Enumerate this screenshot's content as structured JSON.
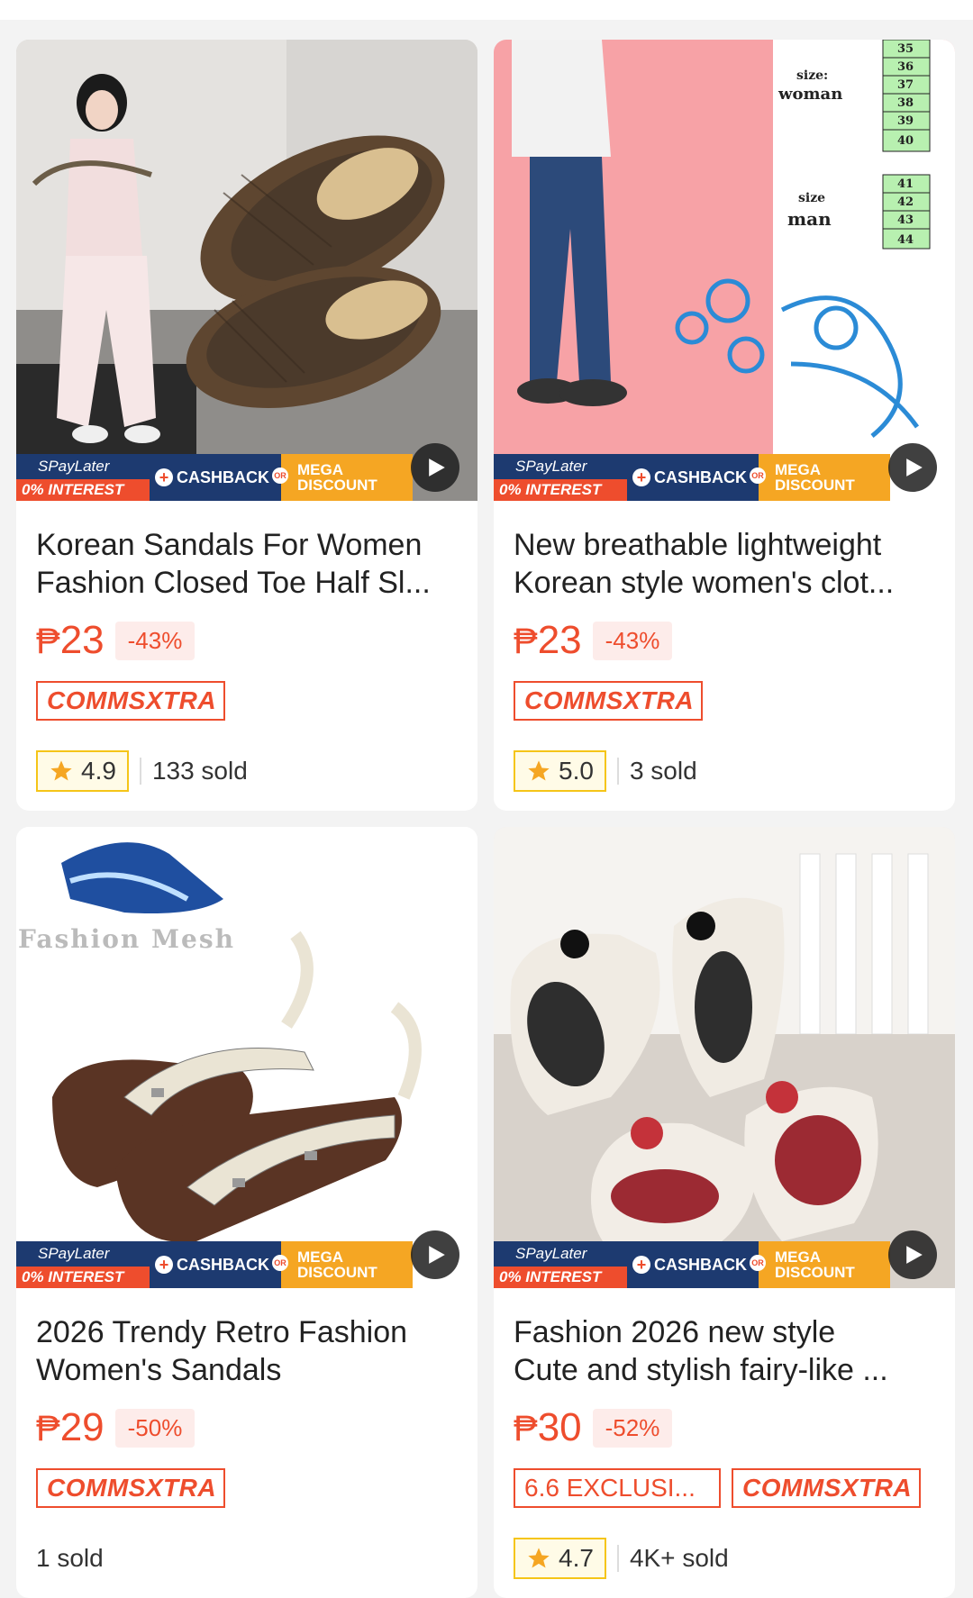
{
  "promo": {
    "spay_label": "SPayLater",
    "spay_interest": "0% INTEREST",
    "cashback": "CASHBACK",
    "or": "OR",
    "mega1": "MEGA",
    "mega2": "DISCOUNT"
  },
  "products": [
    {
      "title_line1": "Korean Sandals For Women",
      "title_line2": "Fashion Closed Toe Half Sl...",
      "currency": "₱",
      "price": "23",
      "discount": "-43%",
      "tags": [
        "COMMSXTRA"
      ],
      "rating": "4.9",
      "sold": "133 sold"
    },
    {
      "title_line1": "New breathable lightweight",
      "title_line2": "Korean style women's clot...",
      "currency": "₱",
      "price": "23",
      "discount": "-43%",
      "tags": [
        "COMMSXTRA"
      ],
      "rating": "5.0",
      "sold": "3 sold",
      "image_text": {
        "size_woman_label": "size:",
        "woman": "woman",
        "size_man_label": "size",
        "man": "man",
        "woman_sizes": [
          "35",
          "36",
          "37",
          "38",
          "39",
          "40"
        ],
        "man_sizes": [
          "41",
          "42",
          "43",
          "44"
        ]
      }
    },
    {
      "title_line1": "2026 Trendy Retro Fashion",
      "title_line2": "Women's Sandals",
      "currency": "₱",
      "price": "29",
      "discount": "-50%",
      "tags": [
        "COMMSXTRA"
      ],
      "rating": "",
      "sold": "1 sold",
      "image_text": {
        "logo": "Fashion Mesh"
      }
    },
    {
      "title_line1": "Fashion 2026 new style",
      "title_line2": "Cute and stylish fairy-like ...",
      "currency": "₱",
      "price": "30",
      "discount": "-52%",
      "tags": [
        "6.6 EXCLUSI...",
        "COMMSXTRA"
      ],
      "rating": "4.7",
      "sold": "4K+ sold"
    }
  ],
  "colors": {
    "accent": "#ee4d2d",
    "navy": "#1d3a70",
    "mega": "#f5a623",
    "star": "#f5c518"
  },
  "icons": [
    "play-icon",
    "star-icon",
    "plus-icon"
  ]
}
